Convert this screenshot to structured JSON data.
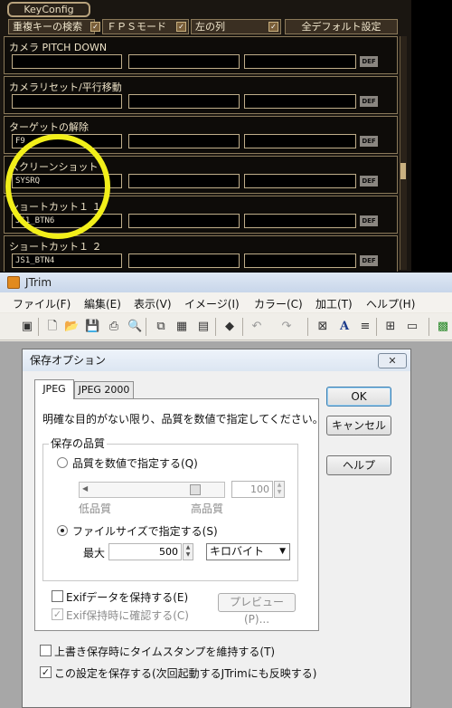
{
  "game": {
    "title": "KeyConfig",
    "toggle_label": "重複キーの検索",
    "mode_label": "ＦＰＳモード",
    "column_label": "左の列",
    "reset_all_label": "全デフォルト設定",
    "def_label": "DEF",
    "rows": [
      {
        "label": "カメラ PITCH DOWN",
        "key1": ""
      },
      {
        "label": "カメラリセット/平行移動",
        "key1": ""
      },
      {
        "label": "ターゲットの解除",
        "key1": "F9"
      },
      {
        "label": "スクリーンショット",
        "key1": "SYSRQ"
      },
      {
        "label": "ショートカット１ １",
        "key1": "JS1_BTN6"
      },
      {
        "label": "ショートカット１ ２",
        "key1": "JS1_BTN4"
      }
    ]
  },
  "jtrim": {
    "title": "JTrim",
    "menu": [
      "ファイル(F)",
      "編集(E)",
      "表示(V)",
      "イメージ(I)",
      "カラー(C)",
      "加工(T)",
      "ヘルプ(H)"
    ],
    "toolbar_icons": [
      "new-window-icon",
      "new-file-icon",
      "open-icon",
      "save-icon",
      "print-icon",
      "print-preview-icon",
      "copy-icon",
      "paste-icon",
      "paste-new-icon",
      "capture-icon",
      "undo-icon",
      "redo-icon",
      "fit-icon",
      "text-icon",
      "align-icon",
      "grid-icon",
      "tile-icon",
      "mosaic-icon"
    ]
  },
  "dialog": {
    "title": "保存オプション",
    "close_label": "✕",
    "tabs": [
      "JPEG",
      "JPEG 2000"
    ],
    "description": "明確な目的がない限り、品質を数値で指定してください。",
    "group_label": "保存の品質",
    "radio_quality": "品質を数値で指定する(Q)",
    "low_quality": "低品質",
    "high_quality": "高品質",
    "quality_value": "100",
    "quality_fraction": 0.85,
    "radio_filesize": "ファイルサイズで指定する(S)",
    "max_label": "最大",
    "max_value": "500",
    "unit_selected": "キロバイト",
    "exif_keep": "Exifデータを保持する(E)",
    "exif_confirm": "Exif保持時に確認する(C)",
    "preview_label": "プレビュー(P)...",
    "ok_label": "OK",
    "cancel_label": "キャンセル",
    "help_label": "ヘルプ",
    "timestamp_label": "上書き保存時にタイムスタンプを維持する(T)",
    "save_settings_label": "この設定を保存する(次回起動するJTrimにも反映する)"
  }
}
